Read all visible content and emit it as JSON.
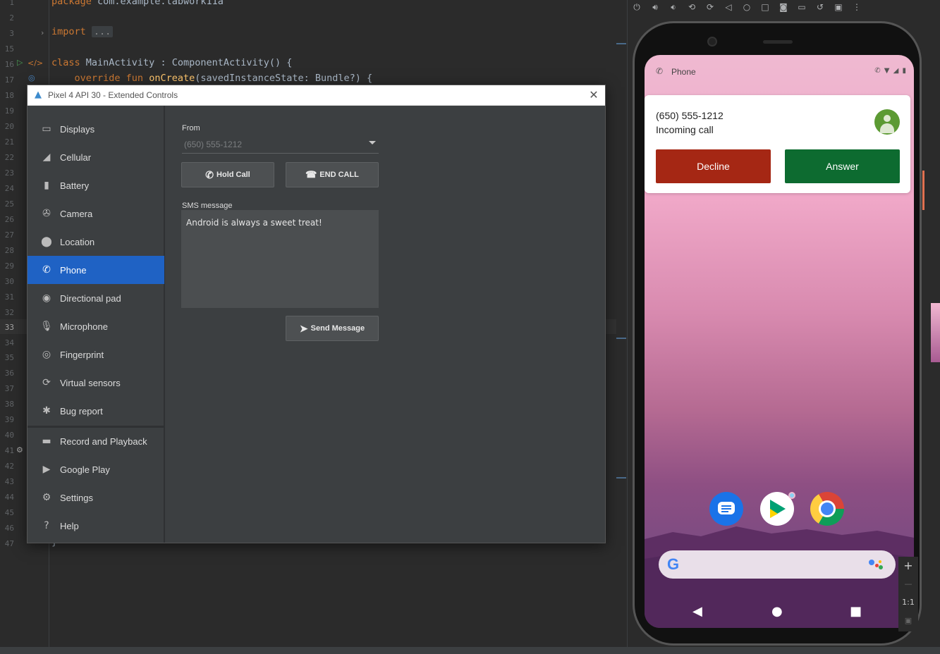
{
  "editor": {
    "lines": [
      {
        "num": "1",
        "text": "package com.example.labwork11a"
      },
      {
        "num": "2",
        "text": ""
      },
      {
        "num": "3",
        "text": "import ..."
      },
      {
        "num": "15",
        "text": ""
      },
      {
        "num": "16",
        "text": "class MainActivity : ComponentActivity() {"
      },
      {
        "num": "17",
        "text": "override fun onCreate(savedInstanceState: Bundle?) {"
      },
      {
        "num": "47",
        "text": "}"
      }
    ],
    "line_numbers": [
      "18",
      "19",
      "20",
      "21",
      "22",
      "23",
      "24",
      "25",
      "26",
      "27",
      "28",
      "29",
      "30",
      "31",
      "32",
      "33",
      "34",
      "35",
      "36",
      "37",
      "38",
      "39",
      "40",
      "41",
      "42",
      "43",
      "44",
      "45",
      "46"
    ]
  },
  "dialog": {
    "title": "Pixel 4 API 30 - Extended Controls",
    "close_icon": "close-icon",
    "sidebar": [
      {
        "label": "Displays",
        "icon": "monitor-icon",
        "active": false
      },
      {
        "label": "Cellular",
        "icon": "signal-icon",
        "active": false
      },
      {
        "label": "Battery",
        "icon": "battery-icon",
        "active": false
      },
      {
        "label": "Camera",
        "icon": "camera-aperture-icon",
        "active": false
      },
      {
        "label": "Location",
        "icon": "location-pin-icon",
        "active": false
      },
      {
        "label": "Phone",
        "icon": "phone-icon",
        "active": true
      },
      {
        "label": "Directional pad",
        "icon": "dpad-icon",
        "active": false
      },
      {
        "label": "Microphone",
        "icon": "microphone-icon",
        "active": false
      },
      {
        "label": "Fingerprint",
        "icon": "fingerprint-icon",
        "active": false
      },
      {
        "label": "Virtual sensors",
        "icon": "rotate-sensor-icon",
        "active": false
      },
      {
        "label": "Bug report",
        "icon": "bug-icon",
        "active": false
      },
      {
        "label": "Record and Playback",
        "icon": "video-camera-icon",
        "active": false
      },
      {
        "label": "Google Play",
        "icon": "play-store-icon",
        "active": false
      },
      {
        "label": "Settings",
        "icon": "gear-icon",
        "active": false
      },
      {
        "label": "Help",
        "icon": "help-icon",
        "active": false
      }
    ],
    "phone": {
      "from_label": "From",
      "from_value": "(650) 555-1212",
      "hold_call": "Hold Call",
      "end_call": "END CALL",
      "sms_label": "SMS message",
      "sms_text": "Android is always a sweet treat!",
      "send_message": "Send Message"
    }
  },
  "device": {
    "status_app": "Phone",
    "notification": {
      "number": "(650) 555-1212",
      "status": "Incoming call",
      "decline": "Decline",
      "answer": "Answer"
    },
    "zoom": {
      "plus": "+",
      "minus": "—",
      "ratio": "1:1"
    },
    "colors": {
      "decline": "#a52714",
      "answer": "#0d6b30",
      "active_nav": "#1f62c4"
    }
  }
}
